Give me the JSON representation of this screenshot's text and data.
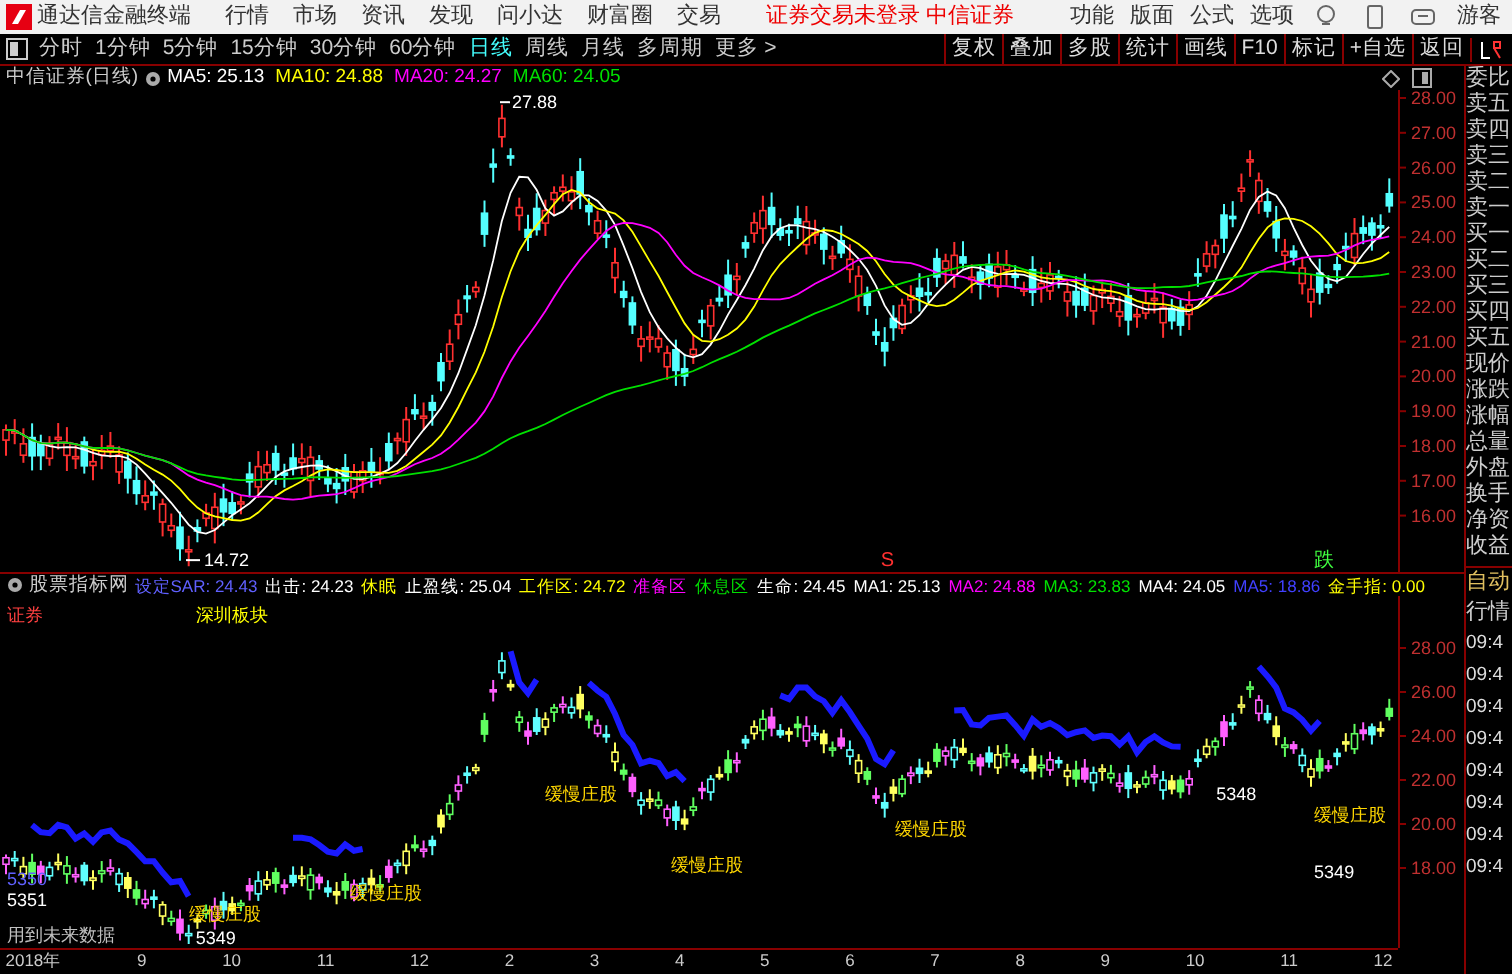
{
  "title_bar": {
    "app_name": "通达信金融终端",
    "menu": [
      "行情",
      "市场",
      "资讯",
      "发现",
      "问小达",
      "财富圈",
      "交易"
    ],
    "login_status": "证券交易未登录",
    "broker": "中信证券",
    "tools": [
      "功能",
      "版面",
      "公式",
      "选项"
    ],
    "user": "游客"
  },
  "toolbar": {
    "periods": [
      {
        "label": "分时",
        "selected": false
      },
      {
        "label": "1分钟",
        "selected": false
      },
      {
        "label": "5分钟",
        "selected": false
      },
      {
        "label": "15分钟",
        "selected": false
      },
      {
        "label": "30分钟",
        "selected": false
      },
      {
        "label": "60分钟",
        "selected": false
      },
      {
        "label": "日线",
        "selected": true
      },
      {
        "label": "周线",
        "selected": false
      },
      {
        "label": "月线",
        "selected": false
      },
      {
        "label": "多周期",
        "selected": false
      },
      {
        "label": "更多 >",
        "selected": false
      }
    ],
    "actions": [
      "复权",
      "叠加",
      "多股",
      "统计",
      "画线",
      "F10",
      "标记",
      "+自选",
      "返回"
    ]
  },
  "main_chart": {
    "title": "中信证券(日线)",
    "ma": [
      {
        "label": "MA5: 25.13",
        "color": "#ffffff"
      },
      {
        "label": "MA10: 24.88",
        "color": "#ffff00"
      },
      {
        "label": "MA20: 24.27",
        "color": "#ff00ff"
      },
      {
        "label": "MA60: 24.05",
        "color": "#00e000"
      }
    ],
    "high_label": "27.88",
    "low_label": "14.72",
    "y_labels": [
      "28.00",
      "27.00",
      "26.00",
      "25.00",
      "24.00",
      "23.00",
      "22.00",
      "21.00",
      "20.00",
      "19.00",
      "18.00",
      "17.00",
      "16.00"
    ],
    "signals": [
      {
        "text": "S",
        "color": "#ff3030"
      },
      {
        "text": "跌",
        "color": "#40ff40"
      }
    ]
  },
  "indicator": {
    "name": "股票指标网",
    "items": [
      {
        "text": "设定SAR: 24.43",
        "color": "#6060ff"
      },
      {
        "text": "出击: 24.23",
        "color": "#ffffff"
      },
      {
        "text": "休眠",
        "color": "#ffff00"
      },
      {
        "text": "止盈线: 25.04",
        "color": "#ffffff"
      },
      {
        "text": "工作区: 24.72",
        "color": "#ffff00"
      },
      {
        "text": "准备区",
        "color": "#ff00ff"
      },
      {
        "text": "休息区",
        "color": "#00e000"
      },
      {
        "text": "生命: 24.45",
        "color": "#ffffff"
      },
      {
        "text": "MA1: 25.13",
        "color": "#ffffff"
      },
      {
        "text": "MA2: 24.88",
        "color": "#ff00ff"
      },
      {
        "text": "MA3: 23.83",
        "color": "#00e000"
      },
      {
        "text": "MA4: 24.05",
        "color": "#ffffff"
      },
      {
        "text": "MA5: 18.86",
        "color": "#4040ff"
      },
      {
        "text": "金手指: 0.00",
        "color": "#ffff00"
      }
    ]
  },
  "lower_chart": {
    "y_labels": [
      "28.00",
      "26.00",
      "24.00",
      "22.00",
      "20.00",
      "18.00"
    ],
    "labels": [
      {
        "text": "证券",
        "color": "#ff4040"
      },
      {
        "text": "深圳板块",
        "color": "#ffff00"
      },
      {
        "text": "5350",
        "color": "#6060ff"
      },
      {
        "text": "5351",
        "color": "#ffffff"
      },
      {
        "text": "用到未来数据",
        "color": "#c0c0c0"
      },
      {
        "text": "缓慢庄股",
        "color": "#ffd700"
      },
      {
        "text": "5349",
        "color": "#ffffff"
      },
      {
        "text": "缓慢庄股",
        "color": "#ffd700"
      },
      {
        "text": "缓慢庄股",
        "color": "#ffd700"
      },
      {
        "text": "缓慢庄股",
        "color": "#ffd700"
      },
      {
        "text": "缓慢庄股",
        "color": "#ffd700"
      },
      {
        "text": "5348",
        "color": "#ffffff"
      },
      {
        "text": "缓慢庄股",
        "color": "#ffd700"
      },
      {
        "text": "5349",
        "color": "#ffffff"
      }
    ]
  },
  "x_axis": [
    "2018年",
    "9",
    "10",
    "11",
    "12",
    "2",
    "3",
    "4",
    "5",
    "6",
    "7",
    "8",
    "9",
    "10",
    "11",
    "12"
  ],
  "quote_panel": {
    "fields": [
      "委比",
      "卖五",
      "卖四",
      "卖三",
      "卖二",
      "卖一",
      "买一",
      "买二",
      "买三",
      "买四",
      "买五",
      "现价",
      "涨跌",
      "涨幅",
      "总量",
      "外盘",
      "换手",
      "净资",
      "收益"
    ],
    "tabs": [
      "自动",
      "行情"
    ],
    "times": [
      "09:4",
      "09:4",
      "09:4",
      "09:4",
      "09:4",
      "09:4",
      "09:4",
      "09:4"
    ]
  }
}
